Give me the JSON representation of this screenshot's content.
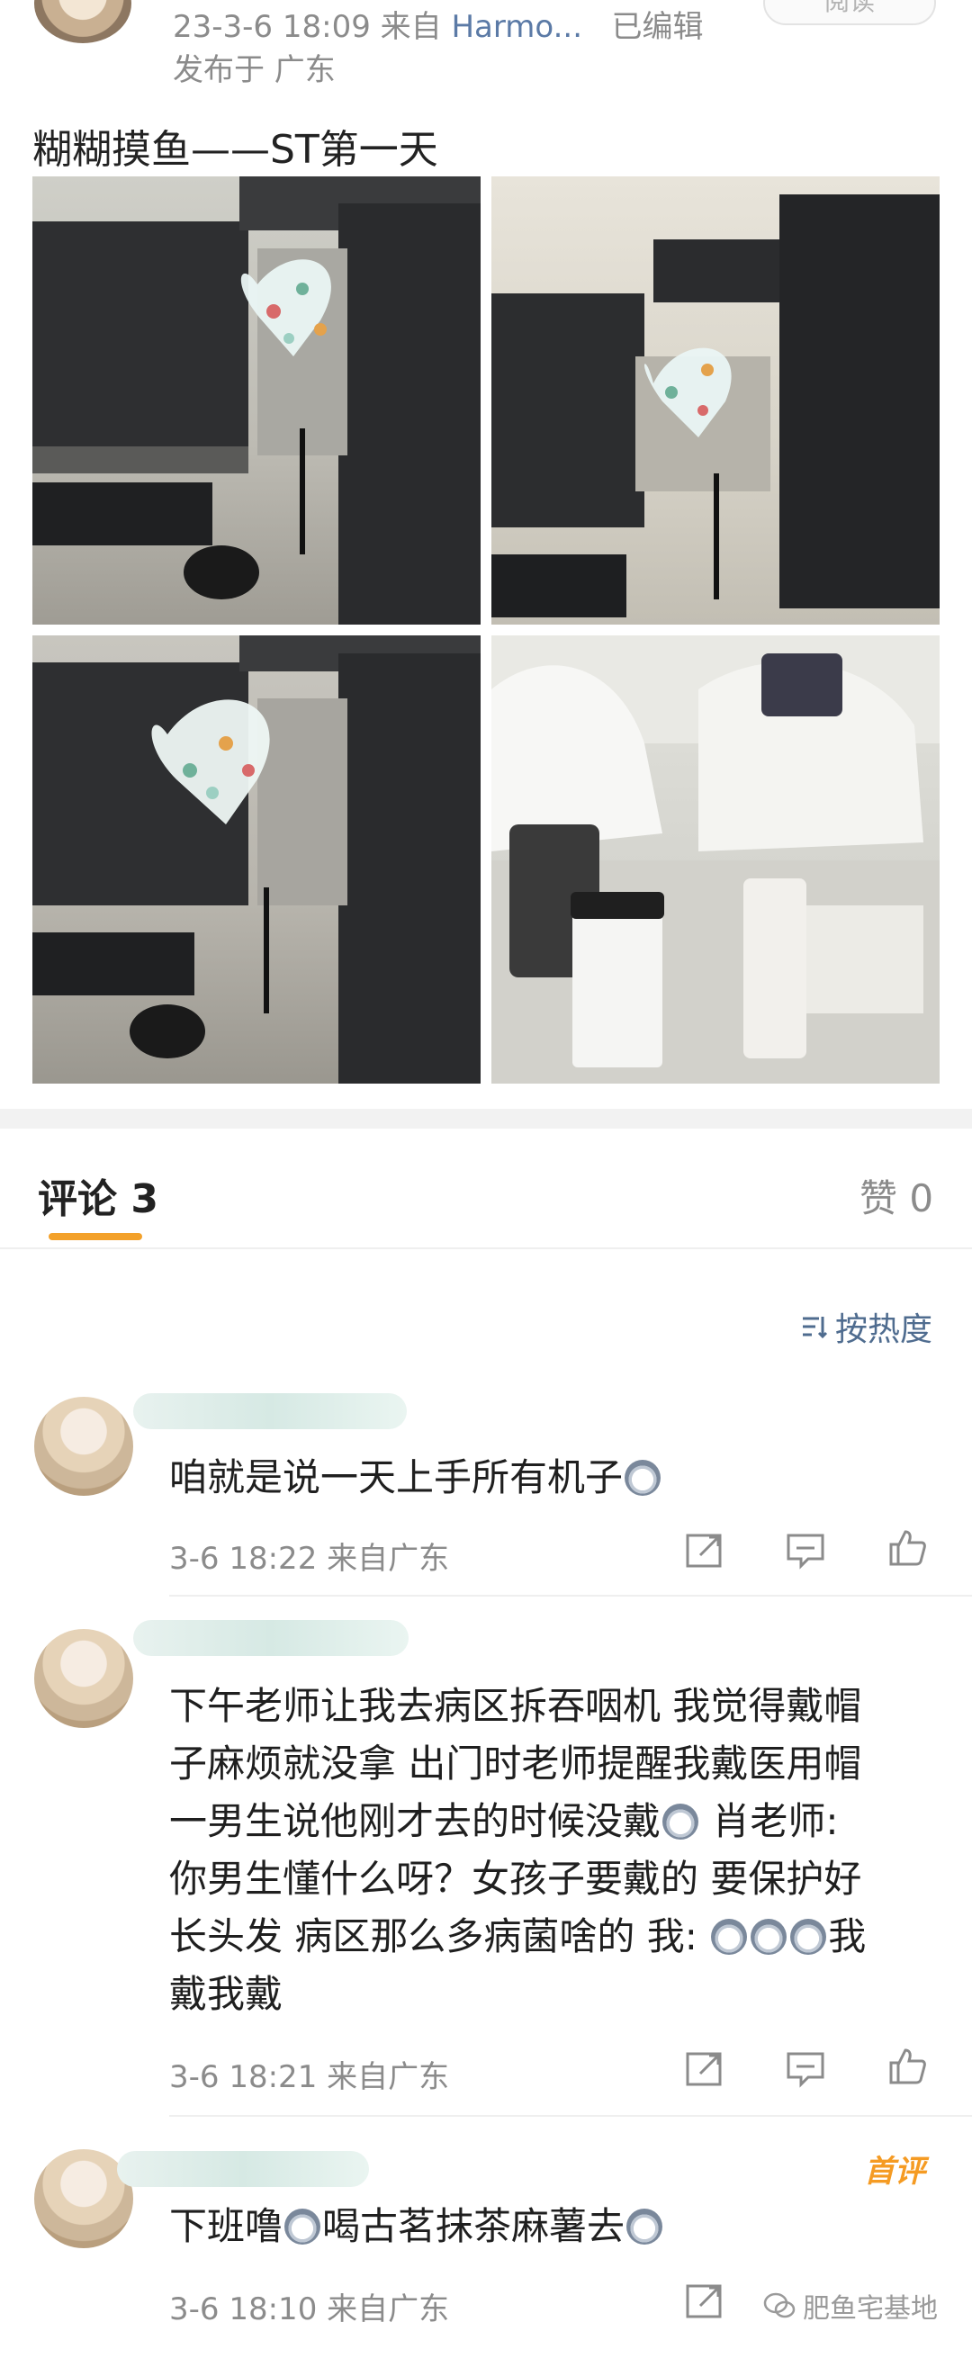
{
  "post": {
    "meta": "23-3-6 18:09  来自",
    "source": "Harmo...",
    "edited": "已编辑",
    "location": "发布于 广东",
    "read_badge": "阅读",
    "title": "糊糊摸鱼——ST第一天"
  },
  "comments_header": {
    "tab_label": "评论 3",
    "likes_label": "赞 0",
    "sort_label": "按热度"
  },
  "comments": [
    {
      "text_parts": [
        "咱就是说一天上手所有机子"
      ],
      "time": "3-6 18:22 来自广东"
    },
    {
      "line1": "下午老师让我去病区拆吞咽机 我觉得戴帽",
      "line2": "子麻烦就没拿 出门时老师提醒我戴医用帽",
      "line3a": "一男生说他刚才去的时候没戴",
      "line3b": " 肖老师:",
      "line4": "你男生懂什么呀？女孩子要戴的  要保护好",
      "line5a": "长头发  病区那么多病菌啥的 我: ",
      "line5b": "我",
      "line6": "戴我戴",
      "time": "3-6 18:21 来自广东"
    },
    {
      "text_a": "下班噜",
      "text_b": "喝古茗抹茶麻薯去",
      "time": "3-6 18:10 来自广东",
      "badge": "首评"
    }
  ],
  "watermark": "肥鱼宅基地",
  "colors": {
    "accent_orange": "#f3a12a",
    "link_blue": "#4f6c8f",
    "meta_gray": "#8b8b8b"
  }
}
